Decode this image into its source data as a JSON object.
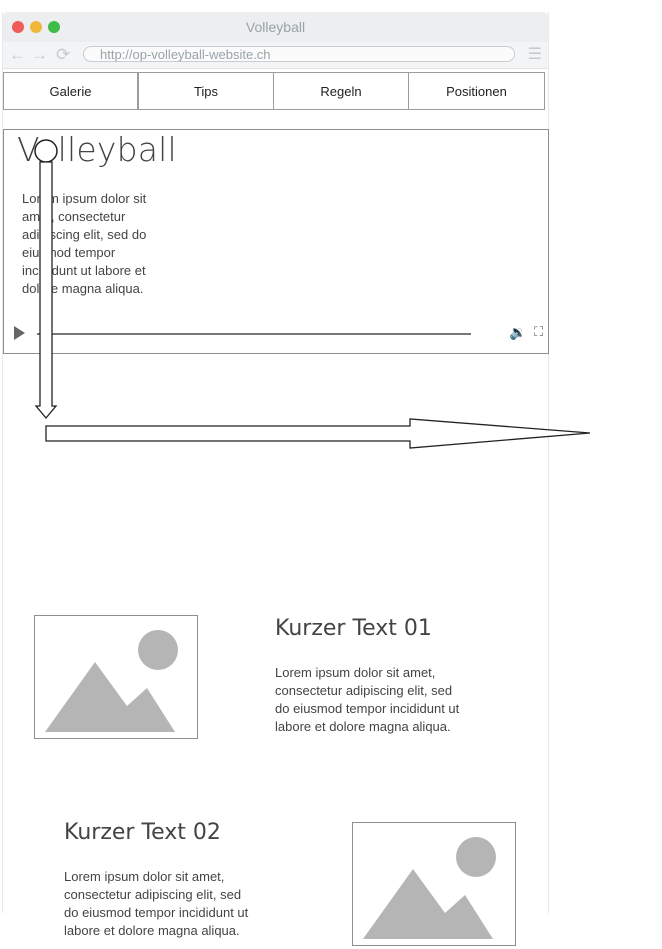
{
  "window": {
    "title": "Volleyball"
  },
  "addressbar": {
    "url": "http://op-volleyball-website.ch",
    "back_icon": "arrow-left-icon",
    "forward_icon": "arrow-right-icon",
    "reload_icon": "reload-icon",
    "menu_icon": "hamburger-menu-icon"
  },
  "nav": {
    "items": [
      {
        "label": "Galerie"
      },
      {
        "label": "Tips"
      },
      {
        "label": "Regeln"
      },
      {
        "label": "Positionen"
      }
    ]
  },
  "hero": {
    "title": "Volleyball",
    "text": "Lorem ipsum dolor sit amet, consectetur adipiscing elit, sed do eiusmod tempor incididunt ut labore et dolore magna aliqua.",
    "controls": {
      "play_icon": "play-icon",
      "volume_icon": "volume-icon",
      "fullscreen_icon": "fullscreen-icon"
    }
  },
  "sections": [
    {
      "title": "Kurzer Text 01",
      "text": "Lorem ipsum dolor sit amet, consectetur adipiscing elit, sed do eiusmod tempor incididunt ut labore et dolore magna aliqua."
    },
    {
      "title": "Kurzer Text 02",
      "text": "Lorem ipsum dolor sit amet, consectetur adipiscing elit, sed do eiusmod tempor incididunt ut labore et dolore magna aliqua."
    }
  ],
  "colors": {
    "placeholder_fill": "#b5b5b5",
    "border": "#8e8e8e",
    "traffic_red": "#ef5b5b",
    "traffic_yellow": "#f1b73a",
    "traffic_green": "#3fbb47"
  }
}
